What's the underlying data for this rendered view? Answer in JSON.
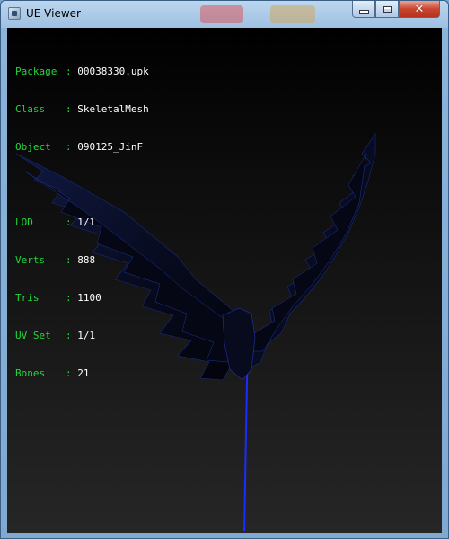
{
  "window": {
    "title": "UE Viewer",
    "icons": {
      "app": "app-icon",
      "minimize": "minimize-icon",
      "maximize": "maximize-icon",
      "close": "close-icon"
    }
  },
  "info": {
    "package_label": "Package",
    "package_value": "00038330.upk",
    "class_label": "Class",
    "class_value": "SkeletalMesh",
    "object_label": "Object",
    "object_value": "090125_JinF",
    "lod_label": "LOD",
    "lod_value": "1/1",
    "verts_label": "Verts",
    "verts_value": "888",
    "tris_label": "Tris",
    "tris_value": "1100",
    "uvset_label": "UV Set",
    "uvset_value": "1/1",
    "bones_label": "Bones",
    "bones_value": "21"
  },
  "colors": {
    "label": "#22d63b",
    "value": "#ffffff",
    "bone_line": "#1a2cff",
    "wing": "#0b0f2a"
  }
}
